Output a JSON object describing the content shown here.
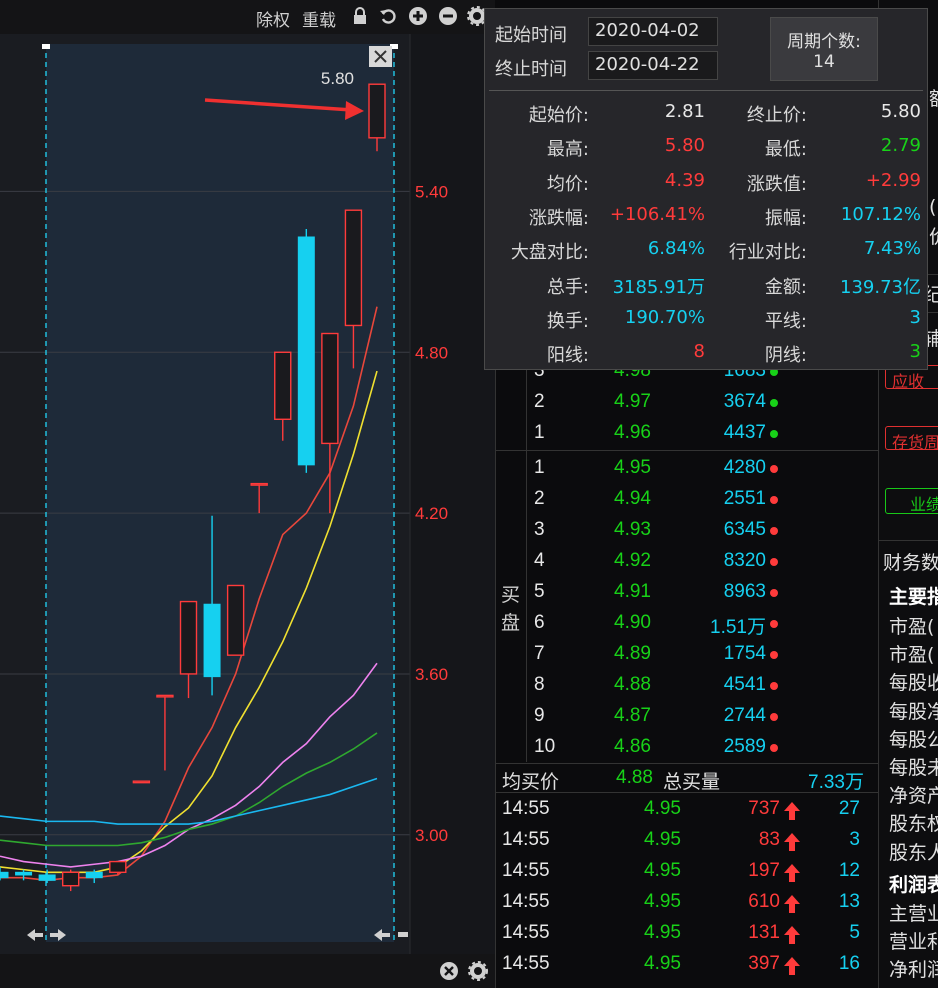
{
  "toolbar": {
    "adjust_label": "除权",
    "reload_label": "重载"
  },
  "colors": {
    "up": "#ff3b3b",
    "down": "#16d0f0",
    "green": "#18d218",
    "cyan": "#16d0f0"
  },
  "icons": [
    "lock-icon",
    "undo-icon",
    "zoom-in-icon",
    "zoom-out-icon",
    "gear-icon",
    "close-icon",
    "arrow-left-icon",
    "arrow-right-icon"
  ],
  "chart_data": {
    "type": "candlestick",
    "ylim": [
      2.6,
      5.95
    ],
    "y_ticks": [
      "5.40",
      "4.80",
      "4.20",
      "3.60",
      "3.00"
    ],
    "y_tick_values": [
      5.4,
      4.8,
      4.2,
      3.6,
      3.0
    ],
    "high_label": "5.80",
    "candles": [
      {
        "o": 2.84,
        "c": 2.86,
        "h": 2.88,
        "l": 2.83,
        "up": false
      },
      {
        "o": 2.85,
        "c": 2.86,
        "h": 2.87,
        "l": 2.83,
        "up": false
      },
      {
        "o": 2.83,
        "c": 2.85,
        "h": 2.87,
        "l": 2.82,
        "up": false
      },
      {
        "o": 2.81,
        "c": 2.86,
        "h": 2.87,
        "l": 2.79,
        "up": true
      },
      {
        "o": 2.84,
        "c": 2.86,
        "h": 2.87,
        "l": 2.82,
        "up": false
      },
      {
        "o": 2.86,
        "c": 2.9,
        "h": 2.9,
        "l": 2.85,
        "up": true
      },
      {
        "o": 3.2,
        "c": 3.2,
        "h": 3.2,
        "l": 3.2,
        "up": true
      },
      {
        "o": 3.52,
        "c": 3.52,
        "h": 3.52,
        "l": 3.24,
        "up": true
      },
      {
        "o": 3.6,
        "c": 3.87,
        "h": 3.87,
        "l": 3.51,
        "up": true
      },
      {
        "o": 3.86,
        "c": 3.59,
        "h": 4.19,
        "l": 3.52,
        "up": false
      },
      {
        "o": 3.67,
        "c": 3.93,
        "h": 3.93,
        "l": 3.67,
        "up": true
      },
      {
        "o": 4.31,
        "c": 4.31,
        "h": 4.31,
        "l": 4.2,
        "up": true
      },
      {
        "o": 4.55,
        "c": 4.8,
        "h": 4.8,
        "l": 4.47,
        "up": true
      },
      {
        "o": 5.23,
        "c": 4.38,
        "h": 5.26,
        "l": 4.35,
        "up": false
      },
      {
        "o": 4.46,
        "c": 4.87,
        "h": 4.87,
        "l": 4.2,
        "up": true
      },
      {
        "o": 4.9,
        "c": 5.33,
        "h": 5.33,
        "l": 4.74,
        "up": true
      },
      {
        "o": 5.6,
        "c": 5.8,
        "h": 5.8,
        "l": 5.55,
        "up": true
      }
    ],
    "series": [
      {
        "color": "#e8473b",
        "values": [
          2.84,
          2.84,
          2.83,
          2.84,
          2.84,
          2.85,
          2.92,
          3.05,
          3.25,
          3.4,
          3.6,
          3.88,
          4.12,
          4.2,
          4.35,
          4.6,
          4.97
        ]
      },
      {
        "color": "#f0e030",
        "values": [
          2.88,
          2.87,
          2.86,
          2.86,
          2.86,
          2.88,
          2.94,
          3.03,
          3.1,
          3.22,
          3.4,
          3.55,
          3.72,
          3.92,
          4.15,
          4.42,
          4.73
        ]
      },
      {
        "color": "#ee82ee",
        "values": [
          2.92,
          2.9,
          2.89,
          2.88,
          2.89,
          2.9,
          2.92,
          2.96,
          3.02,
          3.06,
          3.11,
          3.18,
          3.27,
          3.34,
          3.44,
          3.52,
          3.64
        ]
      },
      {
        "color": "#2fa82f",
        "values": [
          2.98,
          2.97,
          2.96,
          2.96,
          2.96,
          2.96,
          2.97,
          2.99,
          3.02,
          3.04,
          3.07,
          3.12,
          3.18,
          3.23,
          3.27,
          3.32,
          3.38
        ]
      },
      {
        "color": "#1ab8f0",
        "values": [
          3.07,
          3.06,
          3.05,
          3.05,
          3.05,
          3.04,
          3.04,
          3.04,
          3.04,
          3.05,
          3.07,
          3.09,
          3.11,
          3.13,
          3.15,
          3.18,
          3.21
        ]
      }
    ]
  },
  "popup": {
    "start_time_label": "起始时间",
    "start_time_value": "2020-04-02",
    "end_time_label": "终止时间",
    "end_time_value": "2020-04-22",
    "period_label": "周期个数:",
    "period_value": "14",
    "rows": [
      {
        "l1": "起始价:",
        "v1": "2.81",
        "c1": "white",
        "l2": "终止价:",
        "v2": "5.80",
        "c2": "white"
      },
      {
        "l1": "最高:",
        "v1": "5.80",
        "c1": "red",
        "l2": "最低:",
        "v2": "2.79",
        "c2": "green"
      },
      {
        "l1": "均价:",
        "v1": "4.39",
        "c1": "red",
        "l2": "涨跌值:",
        "v2": "+2.99",
        "c2": "red"
      },
      {
        "l1": "涨跌幅:",
        "v1": "+106.41%",
        "c1": "red",
        "l2": "振幅:",
        "v2": "107.12%",
        "c2": "cyan"
      },
      {
        "l1": "大盘对比:",
        "v1": "6.84%",
        "c1": "cyan",
        "l2": "行业对比:",
        "v2": "7.43%",
        "c2": "cyan"
      },
      {
        "l1": "总手:",
        "v1": "3185.91万",
        "c1": "cyan",
        "l2": "金额:",
        "v2": "139.73亿",
        "c2": "cyan"
      },
      {
        "l1": "换手:",
        "v1": "190.70%",
        "c1": "cyan",
        "l2": "平线:",
        "v2": "3",
        "c2": "cyan"
      },
      {
        "l1": "阳线:",
        "v1": "8",
        "c1": "red",
        "l2": "阴线:",
        "v2": "3",
        "c2": "green"
      }
    ]
  },
  "sell_rows": [
    {
      "n": "3",
      "p": "4.98",
      "v": "1683"
    },
    {
      "n": "2",
      "p": "4.97",
      "v": "3674"
    },
    {
      "n": "1",
      "p": "4.96",
      "v": "4437"
    }
  ],
  "buy_label_1": "买",
  "buy_label_2": "盘",
  "buy_rows": [
    {
      "n": "1",
      "p": "4.95",
      "v": "4280"
    },
    {
      "n": "2",
      "p": "4.94",
      "v": "2551"
    },
    {
      "n": "3",
      "p": "4.93",
      "v": "6345"
    },
    {
      "n": "4",
      "p": "4.92",
      "v": "8320"
    },
    {
      "n": "5",
      "p": "4.91",
      "v": "8963"
    },
    {
      "n": "6",
      "p": "4.90",
      "v": "1.51万"
    },
    {
      "n": "7",
      "p": "4.89",
      "v": "1754"
    },
    {
      "n": "8",
      "p": "4.88",
      "v": "4541"
    },
    {
      "n": "9",
      "p": "4.87",
      "v": "2744"
    },
    {
      "n": "10",
      "p": "4.86",
      "v": "2589"
    }
  ],
  "avg_buy": {
    "label": "均买价",
    "value": "4.88",
    "total_label": "总买量",
    "total_value": "7.33万"
  },
  "ticks": [
    {
      "t": "14:55",
      "p": "4.95",
      "v": "737",
      "n": "27"
    },
    {
      "t": "14:55",
      "p": "4.95",
      "v": "83",
      "n": "3"
    },
    {
      "t": "14:55",
      "p": "4.95",
      "v": "197",
      "n": "12"
    },
    {
      "t": "14:55",
      "p": "4.95",
      "v": "610",
      "n": "13"
    },
    {
      "t": "14:55",
      "p": "4.95",
      "v": "131",
      "n": "5"
    },
    {
      "t": "14:55",
      "p": "4.95",
      "v": "397",
      "n": "16"
    }
  ],
  "right": {
    "btn1": "应收",
    "btn2": "存货周",
    "btn3": "业绩",
    "fin_title": "财务数",
    "main_title": "主要指",
    "fin_items": [
      "市盈(",
      "市盈(",
      "每股收",
      "每股净",
      "每股公",
      "每股未",
      "净资产",
      "股东权",
      "股东人"
    ],
    "profit_title": "利润表",
    "profit_items": [
      "主营业",
      "营业利",
      "净利润"
    ],
    "partial_1": "额",
    "partial_2": "(",
    "partial_3": "价",
    "partial_4": "纪",
    "partial_5": "辅"
  }
}
